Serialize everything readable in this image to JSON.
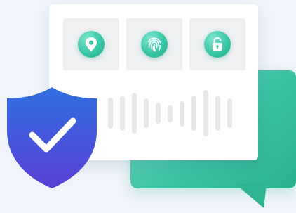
{
  "colors": {
    "background": "#f1f5fb",
    "card": "#ffffff",
    "tile": "#eef0f2",
    "accent_green": "#35c3a3",
    "bubble_green": "#3cc1a3",
    "shield_blue_top": "#2f6fe0",
    "shield_blue_bottom": "#5a3fd6",
    "wave_bar": "#e6e8eb"
  },
  "icons": {
    "tile_1": "location-pin-icon",
    "tile_2": "fingerprint-icon",
    "tile_3": "unlocked-padlock-icon",
    "shield": "shield-check-icon"
  }
}
